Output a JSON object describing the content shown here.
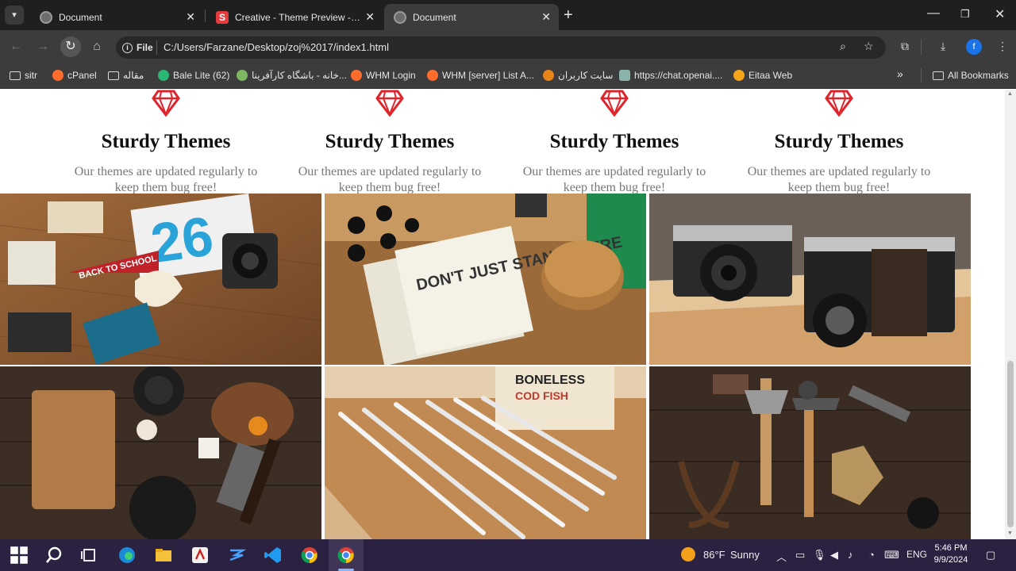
{
  "browser": {
    "tabs": [
      {
        "title": "Document",
        "active": false,
        "favicon": "globe-icon"
      },
      {
        "title": "Creative - Theme Preview - Star",
        "active": false,
        "favicon": "s-logo-icon"
      },
      {
        "title": "Document",
        "active": true,
        "favicon": "globe-icon"
      }
    ],
    "address": {
      "chip_label": "File",
      "url": "C:/Users/Farzane/Desktop/zoj%2017/index1.html"
    },
    "profile_initial": "f",
    "bookmarks": [
      {
        "label": "sitr",
        "icon": "folder-icon"
      },
      {
        "label": "cPanel",
        "icon": "cpanel-icon"
      },
      {
        "label": "مقاله",
        "icon": "folder-icon"
      },
      {
        "label": "Bale Lite (62)",
        "icon": "bale-icon"
      },
      {
        "label": "خانه - باشگاه کارآفرینا...",
        "icon": "club-icon"
      },
      {
        "label": "WHM Login",
        "icon": "cpanel-icon"
      },
      {
        "label": "WHM [server] List A...",
        "icon": "cpanel-icon"
      },
      {
        "label": "سایت کاربران",
        "icon": "fox-icon"
      },
      {
        "label": "https://chat.openai....",
        "icon": "openai-icon"
      },
      {
        "label": "Eitaa Web",
        "icon": "eitaa-icon"
      }
    ],
    "all_bookmarks_label": "All Bookmarks"
  },
  "page": {
    "features": [
      {
        "title": "Sturdy Themes",
        "text": "Our themes are updated regularly to keep them bug free!"
      },
      {
        "title": "Sturdy Themes",
        "text": "Our themes are updated regularly to keep them bug free!"
      },
      {
        "title": "Sturdy Themes",
        "text": "Our themes are updated regularly to keep them bug free!"
      },
      {
        "title": "Sturdy Themes",
        "text": "Our themes are updated regularly to keep them bug free!"
      }
    ],
    "gem_color": "#e0242b",
    "photos": [
      {
        "name": "photo-design-objects",
        "tile_text": "BACK TO SCHOOL"
      },
      {
        "name": "photo-stationery",
        "tile_text": "DON'T JUST STAND THERE"
      },
      {
        "name": "photo-cameras",
        "tile_text": ""
      },
      {
        "name": "photo-kitchen",
        "tile_text": ""
      },
      {
        "name": "photo-pencils",
        "tile_text": "BONELESS"
      },
      {
        "name": "photo-tools",
        "tile_text": ""
      }
    ]
  },
  "taskbar": {
    "weather_temp": "86°F",
    "weather_text": "Sunny",
    "language": "ENG",
    "time": "5:46 PM",
    "date": "9/9/2024",
    "accent": "#2b2140"
  }
}
